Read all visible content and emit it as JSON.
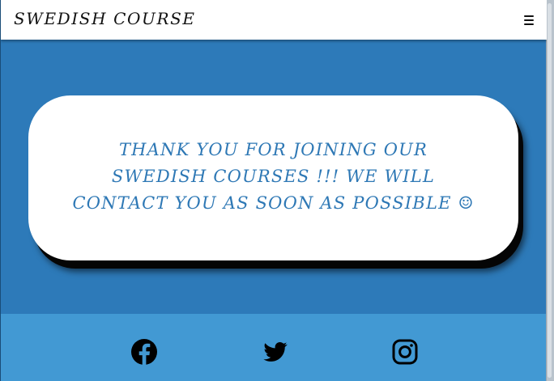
{
  "header": {
    "brand": "SWEDISH COURSE",
    "menu_icon": "hamburger-menu-icon"
  },
  "main": {
    "message": "THANK YOU FOR JOINING OUR SWEDISH COURSES !!! WE WILL CONTACT YOU AS SOON AS POSSIBLE ☺"
  },
  "footer": {
    "icons": [
      "facebook-icon",
      "twitter-icon",
      "instagram-icon"
    ]
  },
  "colors": {
    "primary": "#2d7ab9",
    "footer": "#4299d3",
    "card": "#ffffff",
    "text": "#2e78b5"
  }
}
